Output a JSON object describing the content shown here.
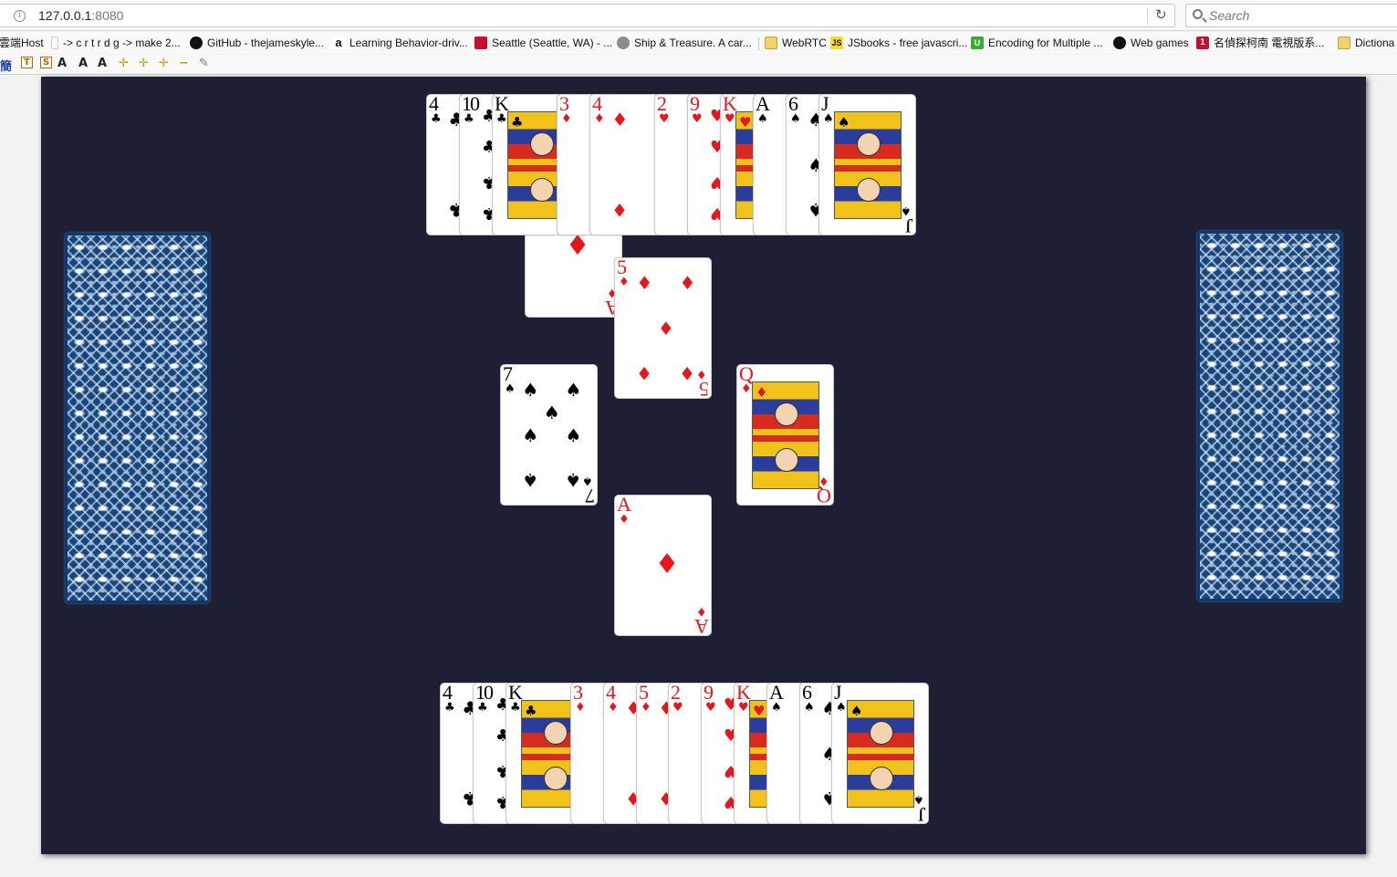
{
  "browser": {
    "url_host": "127.0.0.1",
    "url_port": ":8080",
    "search_placeholder": "Search",
    "bookmarks": [
      {
        "label": "雲端Host",
        "icon": "none"
      },
      {
        "label": "-> c r t r d g -> make 2...",
        "icon": "blank-page-icon"
      },
      {
        "label": "GitHub - thejameskyle...",
        "icon": "github-icon"
      },
      {
        "label": "Learning Behavior-driv...",
        "icon": "amazon-icon"
      },
      {
        "label": "Seattle (Seattle, WA) - ...",
        "icon": "red-logo-icon"
      },
      {
        "label": "Ship & Treasure. A car...",
        "icon": "globe-icon"
      },
      {
        "label": "WebRTC",
        "icon": "folder-icon"
      },
      {
        "label": "JSbooks - free javascri...",
        "icon": "js-icon"
      },
      {
        "label": "Encoding for Multiple ...",
        "icon": "u-logo-icon"
      },
      {
        "label": "Web games",
        "icon": "github-icon"
      },
      {
        "label": "名偵探柯南 電視版系...",
        "icon": "number-badge-icon"
      },
      {
        "label": "Dictiona",
        "icon": "folder-icon"
      }
    ],
    "bookmark_badges": {
      "js": "JS",
      "u": "U",
      "num": "1",
      "amazon": "a"
    },
    "toolbar_glyphs": [
      "簡",
      "T",
      "S",
      "A",
      "A",
      "A",
      "✛",
      "✛",
      "✛",
      "−",
      "✎"
    ],
    "info_glyph": "i",
    "reload_glyph": "↻"
  },
  "game": {
    "table_color": "#1e1f34",
    "card_back_color": "#16467f",
    "north_hand": [
      {
        "rank": "4",
        "suit": "♣",
        "color": "black"
      },
      {
        "rank": "10",
        "suit": "♣",
        "color": "black"
      },
      {
        "rank": "K",
        "suit": "♣",
        "color": "black"
      },
      {
        "rank": "3",
        "suit": "♦",
        "color": "red"
      },
      {
        "rank": "4",
        "suit": "♦",
        "color": "red"
      },
      {
        "rank": "2",
        "suit": "♥",
        "color": "red"
      },
      {
        "rank": "9",
        "suit": "♥",
        "color": "red"
      },
      {
        "rank": "K",
        "suit": "♥",
        "color": "red"
      },
      {
        "rank": "A",
        "suit": "♠",
        "color": "black"
      },
      {
        "rank": "6",
        "suit": "♠",
        "color": "black"
      },
      {
        "rank": "J",
        "suit": "♠",
        "color": "black"
      }
    ],
    "south_hand": [
      {
        "rank": "4",
        "suit": "♣",
        "color": "black"
      },
      {
        "rank": "10",
        "suit": "♣",
        "color": "black"
      },
      {
        "rank": "K",
        "suit": "♣",
        "color": "black"
      },
      {
        "rank": "3",
        "suit": "♦",
        "color": "red"
      },
      {
        "rank": "4",
        "suit": "♦",
        "color": "red"
      },
      {
        "rank": "5",
        "suit": "♦",
        "color": "red"
      },
      {
        "rank": "2",
        "suit": "♥",
        "color": "red"
      },
      {
        "rank": "9",
        "suit": "♥",
        "color": "red"
      },
      {
        "rank": "K",
        "suit": "♥",
        "color": "red"
      },
      {
        "rank": "A",
        "suit": "♠",
        "color": "black"
      },
      {
        "rank": "6",
        "suit": "♠",
        "color": "black"
      },
      {
        "rank": "J",
        "suit": "♠",
        "color": "black"
      }
    ],
    "played": [
      {
        "rank": "A",
        "suit": "♦",
        "color": "red",
        "slot": "north-ace"
      },
      {
        "rank": "5",
        "suit": "♦",
        "color": "red",
        "slot": "center-five"
      },
      {
        "rank": "7",
        "suit": "♠",
        "color": "black",
        "slot": "west"
      },
      {
        "rank": "Q",
        "suit": "♦",
        "color": "red",
        "slot": "east"
      },
      {
        "rank": "A",
        "suit": "♦",
        "color": "red",
        "slot": "south"
      }
    ]
  }
}
